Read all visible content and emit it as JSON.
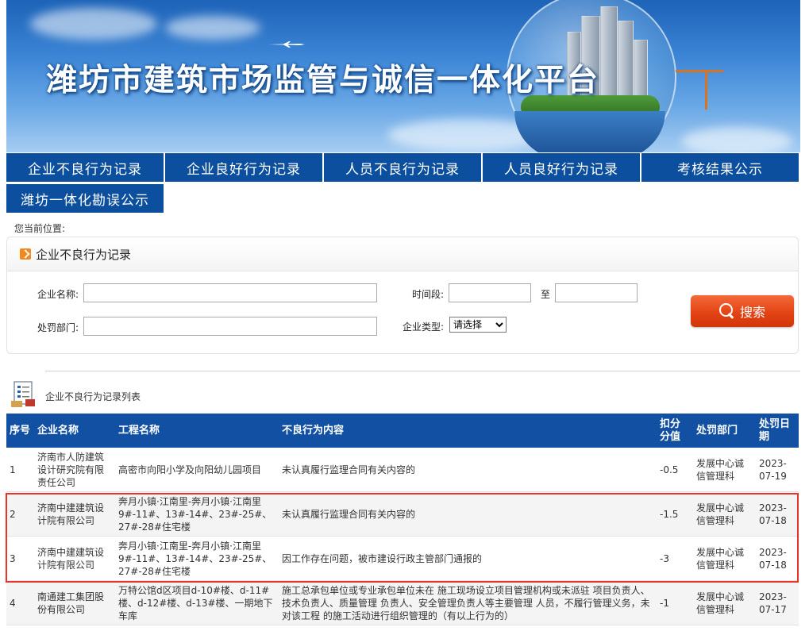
{
  "banner": {
    "title": "潍坊市建筑市场监管与诚信一体化平台"
  },
  "nav": {
    "tabs": [
      {
        "label": "企业不良行为记录"
      },
      {
        "label": "企业良好行为记录"
      },
      {
        "label": "人员不良行为记录"
      },
      {
        "label": "人员良好行为记录"
      },
      {
        "label": "考核结果公示"
      },
      {
        "label": "潍坊一体化勘误公示"
      }
    ],
    "active_color": "#0b4f9e"
  },
  "breadcrumb": {
    "label": "您当前位置:"
  },
  "search_panel": {
    "title": "企业不良行为记录",
    "company_label": "企业名称:",
    "company_value": "",
    "dept_label": "处罚部门:",
    "dept_value": "",
    "period_label": "时间段:",
    "period_to": "至",
    "start_value": "",
    "end_value": "",
    "type_label": "企业类型:",
    "type_selected": "请选择",
    "search_button": "搜索",
    "button_color": "#e44415"
  },
  "list": {
    "title": "企业不良行为记录列表",
    "headers": [
      "序号",
      "企业名称",
      "工程名称",
      "不良行为内容",
      "扣分分值",
      "处罚部门",
      "处罚日期"
    ],
    "rows": [
      {
        "no": "1",
        "company": "济南市人防建筑设计研究院有限责任公司",
        "project": "高密市向阳小学及向阳幼儿园项目",
        "content": "未认真履行监理合同有关内容的",
        "score": "-0.5",
        "dept": "发展中心诚信管理科",
        "date": "2023-07-19"
      },
      {
        "no": "2",
        "company": "济南中建建筑设计院有限公司",
        "project": "奔月小镇·江南里-奔月小镇·江南里9#-11#、13#-14#、23#-25#、27#-28#住宅楼",
        "content": "未认真履行监理合同有关内容的",
        "score": "-1.5",
        "dept": "发展中心诚信管理科",
        "date": "2023-07-18"
      },
      {
        "no": "3",
        "company": "济南中建建筑设计院有限公司",
        "project": "奔月小镇·江南里-奔月小镇·江南里9#-11#、13#-14#、23#-25#、27#-28#住宅楼",
        "content": "因工作存在问题，被市建设行政主管部门通报的",
        "score": "-3",
        "dept": "发展中心诚信管理科",
        "date": "2023-07-18"
      },
      {
        "no": "4",
        "company": "南通建工集团股份有限公司",
        "project": "万特公馆d区项目d-10#楼、d-11#楼、d-12#楼、d-13#楼、一期地下车库",
        "content": "施工总承包单位或专业承包单位未在 施工现场设立项目管理机构或未派驻 项目负责人、技术负责人、质量管理 负责人、安全管理负责人等主要管理 人员，不履行管理义务，未对该工程 的施工活动进行组织管理的（有以上行为的）",
        "score": "-1",
        "dept": "发展中心诚信管理科",
        "date": "2023-07-17"
      }
    ],
    "header_color": "#1250a3",
    "highlight_color": "#e8322b"
  }
}
